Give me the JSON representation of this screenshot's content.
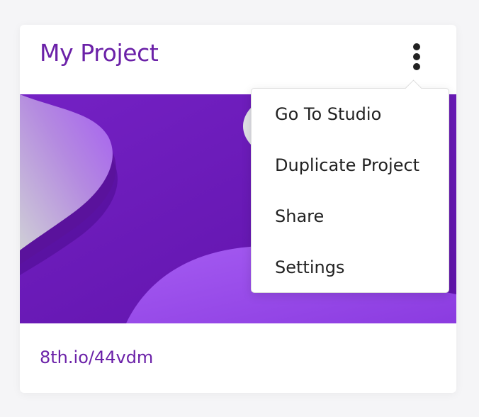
{
  "colors": {
    "brand": "#6b21a8",
    "thumbnail_base": "#6a1bb6",
    "thumbnail_accent": "#a55cf2"
  },
  "project": {
    "title": "My Project",
    "link": "8th.io/44vdm",
    "options_icon": "kebab-vertical-icon"
  },
  "menu": {
    "items": [
      {
        "label": "Go To Studio"
      },
      {
        "label": "Duplicate Project"
      },
      {
        "label": "Share"
      },
      {
        "label": "Settings"
      }
    ]
  }
}
